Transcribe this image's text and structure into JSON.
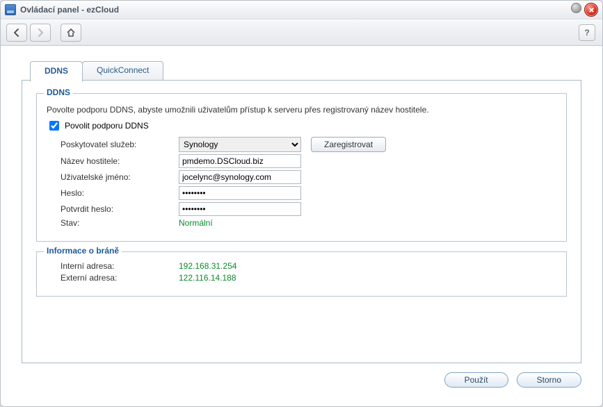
{
  "window": {
    "title": "Ovládací panel - ezCloud"
  },
  "tabs": {
    "ddns": "DDNS",
    "quickconnect": "QuickConnect"
  },
  "ddns": {
    "legend": "DDNS",
    "description": "Povolte podporu DDNS, abyste umožnili uživatelům přístup k serveru přes registrovaný název hostitele.",
    "enable_label": "Povolit podporu DDNS",
    "provider_label": "Poskytovatel služeb:",
    "provider_value": "Synology",
    "register_label": "Zaregistrovat",
    "hostname_label": "Název hostitele:",
    "hostname_value": "pmdemo.DSCloud.biz",
    "username_label": "Uživatelské jméno:",
    "username_value": "jocelync@synology.com",
    "password_label": "Heslo:",
    "password_value": "••••••••",
    "confirm_label": "Potvrdit heslo:",
    "confirm_value": "••••••••",
    "status_label": "Stav:",
    "status_value": "Normální"
  },
  "gateway": {
    "legend": "Informace o bráně",
    "internal_label": "Interní adresa:",
    "internal_value": "192.168.31.254",
    "external_label": "Externí adresa:",
    "external_value": "122.116.14.188"
  },
  "footer": {
    "apply": "Použít",
    "cancel": "Storno"
  },
  "help": "?"
}
